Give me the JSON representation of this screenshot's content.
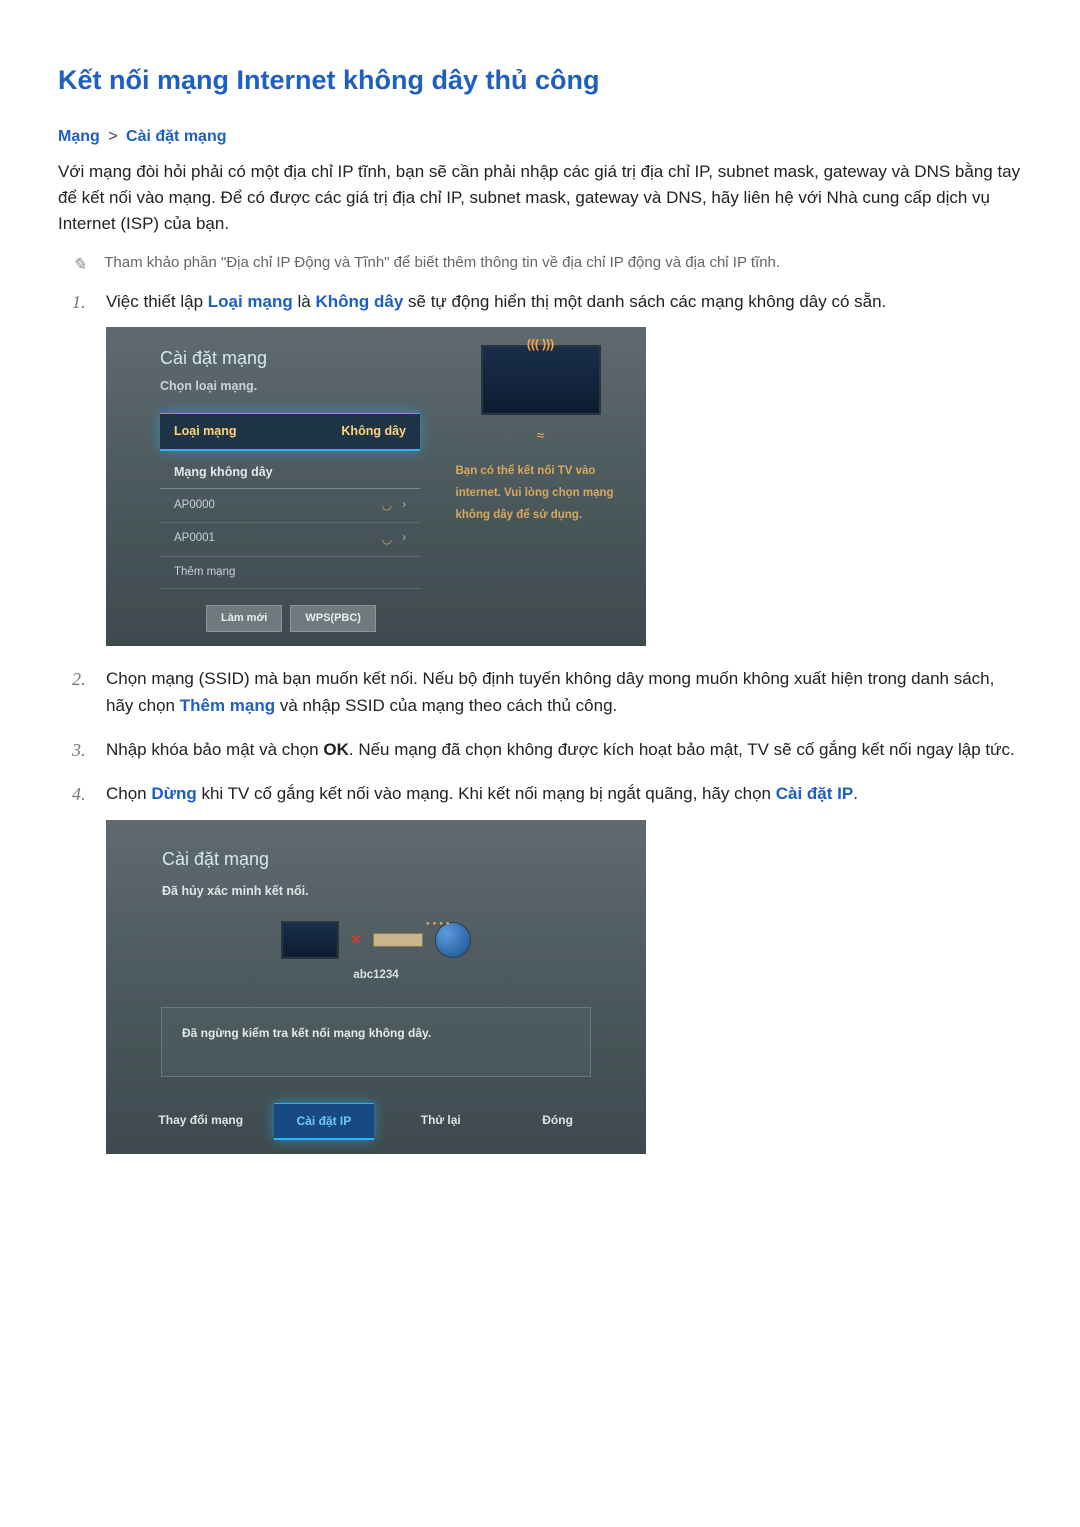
{
  "title": "Kết nối mạng Internet không dây thủ công",
  "breadcrumb": {
    "a": "Mạng",
    "sep": ">",
    "b": "Cài đặt mạng"
  },
  "intro": "Với mạng đòi hỏi phải có một địa chỉ IP tĩnh, bạn sẽ cần phải nhập các giá trị địa chỉ IP, subnet mask, gateway và DNS bằng tay để kết nối vào mạng. Để có được các giá trị địa chỉ IP, subnet mask, gateway và DNS, hãy liên hệ với Nhà cung cấp dịch vụ Internet (ISP) của bạn.",
  "note": "Tham khảo phần \"Địa chỉ IP Động và Tĩnh\" để biết thêm thông tin về địa chỉ IP động và địa chỉ IP tĩnh.",
  "step1": {
    "pre": "Việc thiết lập ",
    "hl1": "Loại mạng",
    "mid": " là ",
    "hl2": "Không dây",
    "post": " sẽ tự động hiển thị một danh sách các mạng không dây có sẵn."
  },
  "panel1": {
    "title": "Cài đặt mạng",
    "sub": "Chọn loại mạng.",
    "net_type_label": "Loại mạng",
    "net_type_value": "Không dây",
    "wifi_header": "Mạng không dây",
    "aps": [
      "AP0000",
      "AP0001"
    ],
    "add_net": "Thêm mạng",
    "info": {
      "l1": "Bạn có thể kết nối TV vào",
      "l2": "internet. Vui lòng chọn mạng",
      "l3": "không dây để sử dụng."
    },
    "btn_refresh": "Làm mới",
    "btn_wps": "WPS(PBC)"
  },
  "step2": {
    "pre": "Chọn mạng (SSID) mà bạn muốn kết nối. Nếu bộ định tuyến không dây mong muốn không xuất hiện trong danh sách, hãy chọn ",
    "hl": "Thêm mạng",
    "post": " và nhập SSID của mạng theo cách thủ công."
  },
  "step3": {
    "pre": "Nhập khóa bảo mật và chọn ",
    "hl": "OK",
    "post": ". Nếu mạng đã chọn không được kích hoạt bảo mật, TV sẽ cố gắng kết nối ngay lập tức."
  },
  "step4": {
    "pre": "Chọn ",
    "hl1": "Dừng",
    "mid": " khi TV cố gắng kết nối vào mạng. Khi kết nối mạng bị ngắt quãng, hãy chọn ",
    "hl2": "Cài đặt IP",
    "post": "."
  },
  "panel2": {
    "title": "Cài đặt mạng",
    "sub": "Đã hủy xác minh kết nối.",
    "diag_label": "abc1234",
    "status": "Đã ngừng kiểm tra kết nối mạng không dây.",
    "buttons": {
      "change": "Thay đổi mạng",
      "ip": "Cài đặt IP",
      "retry": "Thử lại",
      "close": "Đóng"
    }
  }
}
